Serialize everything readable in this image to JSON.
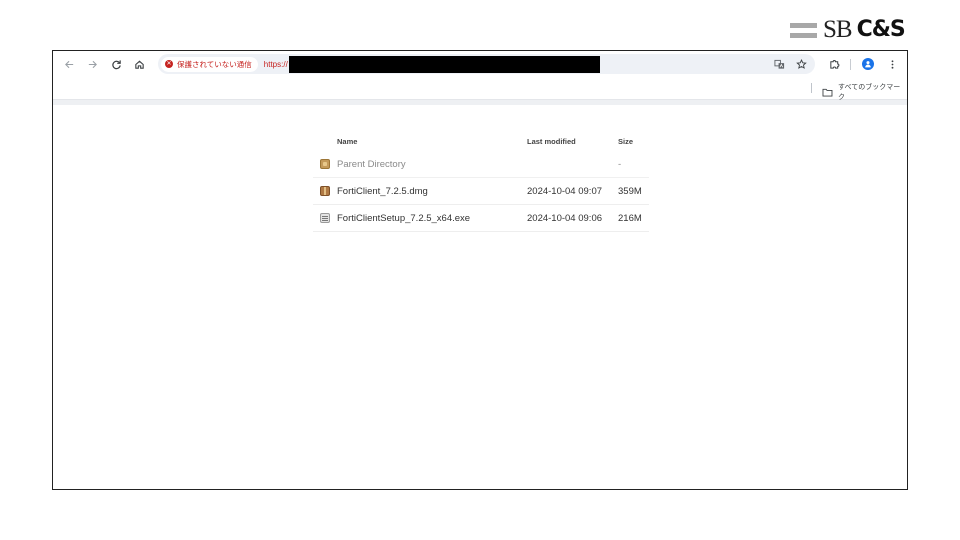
{
  "logo": {
    "sb": "SB",
    "cs": "C&S"
  },
  "browser": {
    "security_label": "保護されていない通信",
    "url_scheme": "https://",
    "bookmarks_all": "すべてのブックマーク"
  },
  "listing": {
    "headers": {
      "name": "Name",
      "modified": "Last modified",
      "size": "Size"
    },
    "rows": [
      {
        "name": "Parent Directory",
        "modified": "",
        "size": "-",
        "icon": "folder-icon"
      },
      {
        "name": "FortiClient_7.2.5.dmg",
        "modified": "2024-10-04 09:07",
        "size": "359M",
        "icon": "package-icon"
      },
      {
        "name": "FortiClientSetup_7.2.5_x64.exe",
        "modified": "2024-10-04 09:06",
        "size": "216M",
        "icon": "binary-file-icon"
      }
    ]
  }
}
